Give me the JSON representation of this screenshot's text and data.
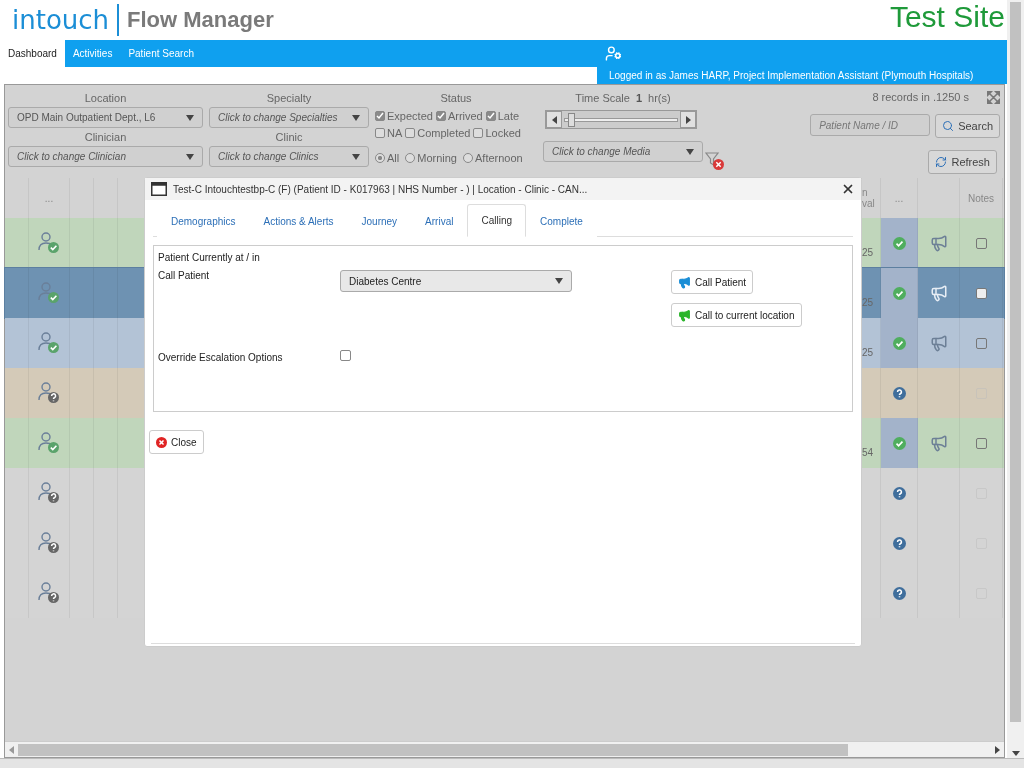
{
  "header": {
    "logo_brand": "intouch",
    "logo_product": "Flow Manager",
    "site": "Test Site"
  },
  "nav": {
    "tabs": [
      {
        "label": "Dashboard",
        "selected": true
      },
      {
        "label": "Activities",
        "selected": false
      },
      {
        "label": "Patient Search",
        "selected": false
      }
    ],
    "logged_in": "Logged in as James HARP, Project Implementation Assistant (Plymouth Hospitals)"
  },
  "filters": {
    "location": {
      "label": "Location",
      "value": "OPD Main Outpatient Dept., L6"
    },
    "specialty": {
      "label": "Specialty",
      "placeholder": "Click to change Specialties"
    },
    "clinician": {
      "label": "Clinician",
      "placeholder": "Click to change Clinician"
    },
    "clinic": {
      "label": "Clinic",
      "placeholder": "Click to change Clinics"
    },
    "status": {
      "label": "Status",
      "options": [
        {
          "label": "Expected",
          "checked": true
        },
        {
          "label": "Arrived",
          "checked": true
        },
        {
          "label": "Late",
          "checked": true
        },
        {
          "label": "NA",
          "checked": false
        },
        {
          "label": "Completed",
          "checked": false
        },
        {
          "label": "Locked",
          "checked": false
        }
      ]
    },
    "session": [
      {
        "label": "All",
        "selected": true
      },
      {
        "label": "Morning",
        "selected": false
      },
      {
        "label": "Afternoon",
        "selected": false
      }
    ],
    "time_scale": {
      "label": "Time Scale",
      "value": "1",
      "unit": "hr(s)",
      "level": 0.05
    },
    "media": {
      "placeholder": "Click to change Media"
    },
    "records": "8 records in .1250 s",
    "search": {
      "placeholder": "Patient Name / ID",
      "button": "Search"
    },
    "refresh": "Refresh"
  },
  "table": {
    "columns": {
      "left": "...",
      "fragment_1": "n",
      "fragment_2": "val",
      "status": "...",
      "notes": "Notes"
    },
    "rows": [
      {
        "selected": false,
        "color": "#c0d6bb",
        "arrived": true,
        "fragment": "25",
        "confirmed": true,
        "megaphone": true,
        "notes_checked": false,
        "notes_disabled": false
      },
      {
        "selected": true,
        "color": "#6e92b2",
        "arrived": true,
        "fragment": "25",
        "confirmed": true,
        "megaphone": true,
        "notes_checked": false,
        "notes_disabled": false
      },
      {
        "selected": false,
        "color": "#b3c3d6",
        "arrived": true,
        "fragment": "25",
        "confirmed": true,
        "megaphone": true,
        "notes_checked": false,
        "notes_disabled": false
      },
      {
        "selected": false,
        "color": "#d4cab8",
        "arrived": false,
        "confirmed": false,
        "megaphone": false,
        "notes_checked": false,
        "notes_disabled": true
      },
      {
        "selected": false,
        "color": "#c0d6bb",
        "arrived": true,
        "fragment": "54",
        "confirmed": true,
        "megaphone": true,
        "notes_checked": false,
        "notes_disabled": false
      },
      {
        "selected": false,
        "color": "#d4d4d4",
        "arrived": false,
        "confirmed": false,
        "megaphone": false,
        "notes_checked": false,
        "notes_disabled": true
      },
      {
        "selected": false,
        "color": "#d4d4d4",
        "arrived": false,
        "confirmed": false,
        "megaphone": false,
        "notes_checked": false,
        "notes_disabled": true
      },
      {
        "selected": false,
        "color": "#d4d4d4",
        "arrived": false,
        "confirmed": false,
        "megaphone": false,
        "notes_checked": false,
        "notes_disabled": true
      }
    ]
  },
  "dialog": {
    "title": "Test-C Intouchtestbp-C (F) (Patient ID - K017963 | NHS Number - ) | Location - Clinic - CAN...",
    "tabs": [
      {
        "label": "Demographics",
        "selected": false
      },
      {
        "label": "Actions & Alerts",
        "selected": false
      },
      {
        "label": "Journey",
        "selected": false
      },
      {
        "label": "Arrival",
        "selected": false
      },
      {
        "label": "Calling",
        "selected": true
      },
      {
        "label": "Complete",
        "selected": false
      }
    ],
    "heading": "Patient Currently at / in",
    "call_label": "Call Patient",
    "call_location": "Diabetes Centre",
    "call_button": "Call Patient",
    "call_current_button": "Call to current location",
    "override": {
      "label": "Override Escalation Options",
      "checked": false
    },
    "close": "Close"
  }
}
